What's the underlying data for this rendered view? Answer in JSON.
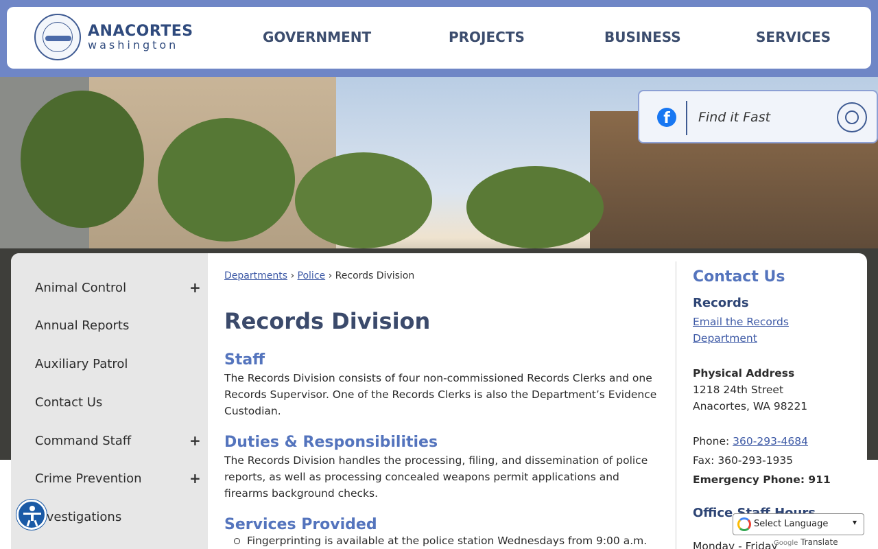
{
  "header": {
    "logo_name": "ANACORTES",
    "logo_sub": "washington",
    "nav": [
      "GOVERNMENT",
      "PROJECTS",
      "BUSINESS",
      "SERVICES"
    ]
  },
  "search": {
    "placeholder": "Find it Fast"
  },
  "sidebar": {
    "items": [
      {
        "label": "Animal Control",
        "expandable": true
      },
      {
        "label": "Annual Reports",
        "expandable": false
      },
      {
        "label": "Auxiliary Patrol",
        "expandable": false
      },
      {
        "label": "Contact Us",
        "expandable": false
      },
      {
        "label": "Command Staff",
        "expandable": true
      },
      {
        "label": "Crime Prevention",
        "expandable": true
      },
      {
        "label": "Investigations",
        "expandable": false
      }
    ],
    "plus_symbol": "+"
  },
  "breadcrumb": {
    "items": [
      "Departments",
      "Police",
      "Records Division"
    ],
    "separator": "›"
  },
  "main": {
    "title": "Records Division",
    "sections": [
      {
        "heading": "Staff",
        "body": "The Records Division consists of four non-commissioned Records Clerks and one Records Supervisor. One of the Records Clerks is also the Department’s Evidence Custodian."
      },
      {
        "heading": "Duties & Responsibilities",
        "body": "The Records Division handles the processing, filing, and dissemination of police reports, as well as processing concealed weapons permit applications and firearms background checks."
      },
      {
        "heading": "Services Provided",
        "bullets": [
          "Fingerprinting is available at the police station Wednesdays from 9:00 a.m."
        ]
      }
    ]
  },
  "contact": {
    "title": "Contact Us",
    "subtitle": "Records",
    "email_line1": "Email the Records",
    "email_line2": "Department",
    "address_label": "Physical Address",
    "address_line1": "1218 24th Street",
    "address_line2": "Anacortes, WA 98221",
    "phone_label": "Phone: ",
    "phone": "360-293-4684",
    "fax": "Fax: 360-293-1935",
    "emergency": "Emergency Phone: 911",
    "office_hours_title": "Office Staff Hours",
    "office_hours_line": "Monday - Friday"
  },
  "translate": {
    "label": "Select Language",
    "powered_google": "Google",
    "powered_text": "Translate"
  },
  "colors": {
    "header_band": "#6f86c6",
    "heading_blue": "#5474bd",
    "title_navy": "#3b4a6b",
    "link_blue": "#3e5aa6"
  }
}
